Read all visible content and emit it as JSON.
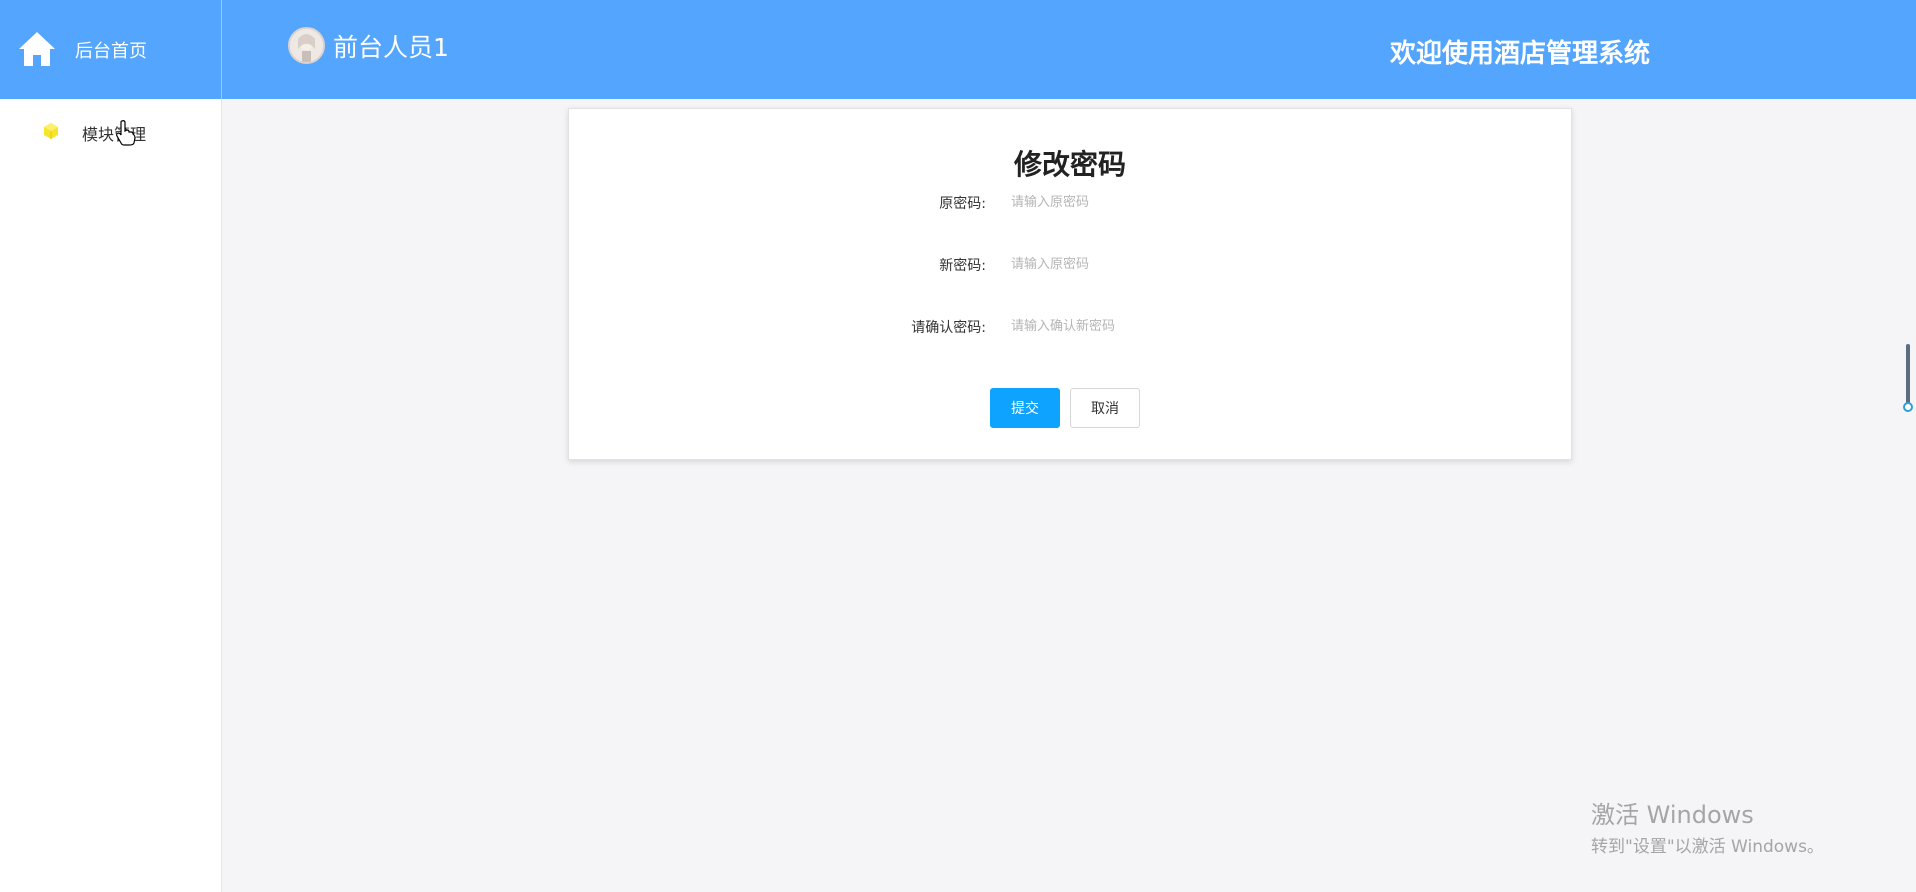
{
  "header": {
    "brand_label": "后台首页",
    "user_name": "前台人员1",
    "welcome_text": "欢迎使用酒店管理系统",
    "background_color": "#53a5fd"
  },
  "sidebar": {
    "items": [
      {
        "label": "模块管理",
        "icon": "cube-icon",
        "icon_color": "#f7e52c"
      }
    ]
  },
  "form": {
    "title": "修改密码",
    "fields": [
      {
        "label": "原密码:",
        "placeholder": "请输入原密码",
        "value": ""
      },
      {
        "label": "新密码:",
        "placeholder": "请输入原密码",
        "value": ""
      },
      {
        "label": "请确认密码:",
        "placeholder": "请输入确认新密码",
        "value": ""
      }
    ],
    "submit_label": "提交",
    "cancel_label": "取消",
    "submit_color": "#0ea3ff"
  },
  "watermark": {
    "title": "激活 Windows",
    "subtitle": "转到\"设置\"以激活 Windows。"
  }
}
